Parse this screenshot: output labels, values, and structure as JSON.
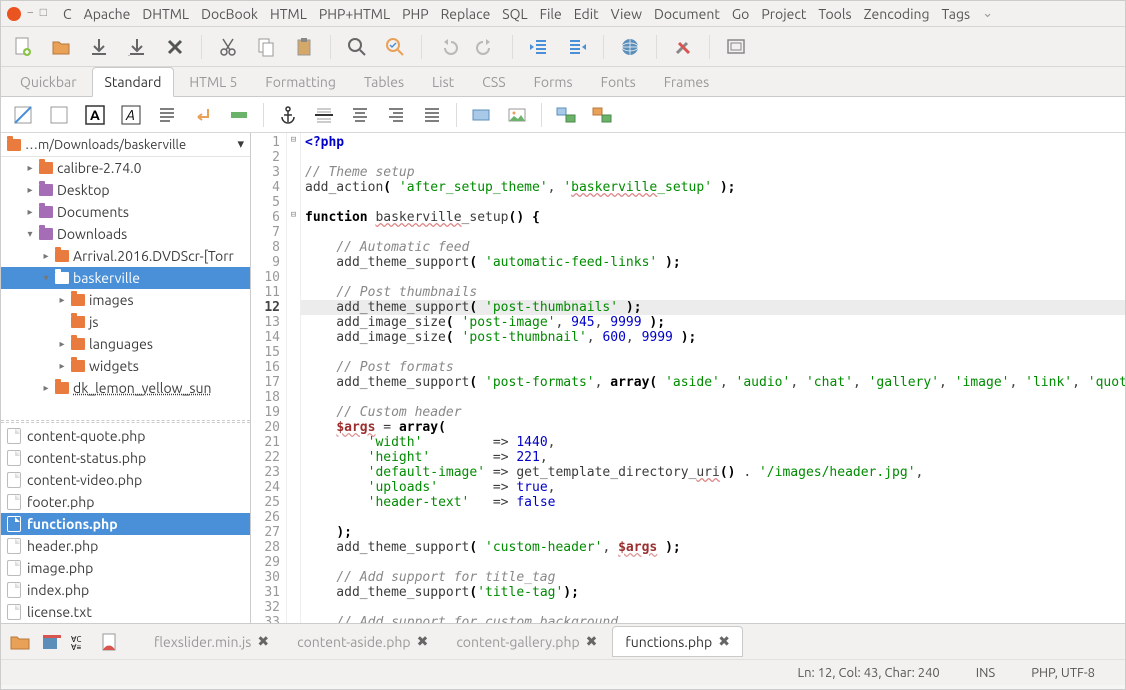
{
  "menus": [
    "C",
    "Apache",
    "DHTML",
    "DocBook",
    "HTML",
    "PHP+HTML",
    "PHP",
    "Replace",
    "SQL",
    "File",
    "Edit",
    "View",
    "Document",
    "Go",
    "Project",
    "Tools",
    "Zencoding",
    "Tags"
  ],
  "toolbar_tabs": [
    "Quickbar",
    "Standard",
    "HTML 5",
    "Formatting",
    "Tables",
    "List",
    "CSS",
    "Forms",
    "Fonts",
    "Frames"
  ],
  "active_toolbar_tab": 1,
  "path": "…m/Downloads/baskerville",
  "tree": [
    {
      "label": "calibre-2.74.0",
      "depth": 1,
      "exp": "▸",
      "folder": true
    },
    {
      "label": "Desktop",
      "depth": 1,
      "exp": "▸",
      "folder": true,
      "purple": true
    },
    {
      "label": "Documents",
      "depth": 1,
      "exp": "▸",
      "folder": true,
      "purple": true
    },
    {
      "label": "Downloads",
      "depth": 1,
      "exp": "▾",
      "folder": true,
      "purple": true
    },
    {
      "label": "Arrival.2016.DVDScr-[Torr",
      "depth": 2,
      "exp": "▸",
      "folder": true
    },
    {
      "label": "baskerville",
      "depth": 2,
      "exp": "▾",
      "folder": true,
      "selected": true
    },
    {
      "label": "images",
      "depth": 3,
      "exp": "▸",
      "folder": true
    },
    {
      "label": "js",
      "depth": 3,
      "exp": "",
      "folder": true
    },
    {
      "label": "languages",
      "depth": 3,
      "exp": "▸",
      "folder": true
    },
    {
      "label": "widgets",
      "depth": 3,
      "exp": "▸",
      "folder": true
    },
    {
      "label": "dk_lemon_yellow_sun",
      "depth": 2,
      "exp": "▸",
      "folder": true,
      "cut": true
    }
  ],
  "files": [
    {
      "name": "content-quote.php"
    },
    {
      "name": "content-status.php"
    },
    {
      "name": "content-video.php"
    },
    {
      "name": "footer.php"
    },
    {
      "name": "functions.php",
      "selected": true
    },
    {
      "name": "header.php"
    },
    {
      "name": "image.php"
    },
    {
      "name": "index.php"
    },
    {
      "name": "license.txt"
    }
  ],
  "doc_tabs": [
    {
      "name": "flexslider.min.js",
      "close": true
    },
    {
      "name": "content-aside.php",
      "close": true
    },
    {
      "name": "content-gallery.php",
      "close": true
    },
    {
      "name": "functions.php",
      "close": true,
      "active": true
    }
  ],
  "status": {
    "pos": "Ln: 12, Col: 43, Char: 240",
    "ins": "INS",
    "mode": "PHP, UTF-8"
  },
  "code_lines": [
    {
      "n": 1,
      "fold": "⊟",
      "html": "<span class='phptag'>&lt;?php</span>"
    },
    {
      "n": 2,
      "html": ""
    },
    {
      "n": 3,
      "html": "<span class='cmt'>// Theme setup</span>"
    },
    {
      "n": 4,
      "html": "add_action<span class='kw'>(</span> <span class='str'>'after_setup_theme'</span>, <span class='str'>'<span class='spell'>baskerville</span>_setup'</span> <span class='kw'>);</span>"
    },
    {
      "n": 5,
      "html": ""
    },
    {
      "n": 6,
      "fold": "⊟",
      "html": "<span class='kw'>function</span> <span class='spell'>baskerville</span>_setup<span class='kw'>() {</span>"
    },
    {
      "n": 7,
      "html": ""
    },
    {
      "n": 8,
      "html": "    <span class='cmt'>// Automatic feed</span>"
    },
    {
      "n": 9,
      "html": "    add_theme_support<span class='kw'>(</span> <span class='str'>'automatic-feed-links'</span> <span class='kw'>);</span>"
    },
    {
      "n": 10,
      "html": ""
    },
    {
      "n": 11,
      "html": "    <span class='cmt'>// Post thumbnails</span>"
    },
    {
      "n": 12,
      "bold": true,
      "hl": true,
      "html": "    add_theme_support<span class='kw'>(</span> <span class='str'>'post-thumbnails'</span> <span class='kw'>);</span>"
    },
    {
      "n": 13,
      "html": "    add_image_size<span class='kw'>(</span> <span class='str'>'post-image'</span>, <span class='num'>945</span>, <span class='num'>9999</span> <span class='kw'>);</span>"
    },
    {
      "n": 14,
      "html": "    add_image_size<span class='kw'>(</span> <span class='str'>'post-thumbnail'</span>, <span class='num'>600</span>, <span class='num'>9999</span> <span class='kw'>);</span>"
    },
    {
      "n": 15,
      "html": ""
    },
    {
      "n": 16,
      "html": "    <span class='cmt'>// Post formats</span>"
    },
    {
      "n": 17,
      "html": "    add_theme_support<span class='kw'>(</span> <span class='str'>'post-formats'</span>, <span class='kw'>array(</span> <span class='str'>'aside'</span>, <span class='str'>'audio'</span>, <span class='str'>'chat'</span>, <span class='str'>'gallery'</span>, <span class='str'>'image'</span>, <span class='str'>'link'</span>, <span class='str'>'quot</span>"
    },
    {
      "n": 18,
      "html": ""
    },
    {
      "n": 19,
      "html": "    <span class='cmt'>// Custom header</span>"
    },
    {
      "n": 20,
      "html": "    <span class='var'>$args</span> = <span class='kw'>array(</span>"
    },
    {
      "n": 21,
      "html": "        <span class='str'>'width'</span>         =&gt; <span class='num'>1440</span>,"
    },
    {
      "n": 22,
      "html": "        <span class='str'>'height'</span>        =&gt; <span class='num'>221</span>,"
    },
    {
      "n": 23,
      "html": "        <span class='str'>'default-image'</span> =&gt; get_template_directory_<span class='spell'>uri</span><span class='kw'>()</span> . <span class='str'>'/images/header.jpg'</span>,"
    },
    {
      "n": 24,
      "html": "        <span class='str'>'uploads'</span>       =&gt; <span class='num'>true</span>,"
    },
    {
      "n": 25,
      "html": "        <span class='str'>'header-text'</span>   =&gt; <span class='num'>false</span>"
    },
    {
      "n": 26,
      "html": ""
    },
    {
      "n": 27,
      "html": "    <span class='kw'>);</span>"
    },
    {
      "n": 28,
      "html": "    add_theme_support<span class='kw'>(</span> <span class='str'>'custom-header'</span>, <span class='var'>$args</span> <span class='kw'>);</span>"
    },
    {
      "n": 29,
      "html": ""
    },
    {
      "n": 30,
      "html": "    <span class='cmt'>// Add support for title_tag</span>"
    },
    {
      "n": 31,
      "html": "    add_theme_support<span class='kw'>(</span><span class='str'>'title-tag'</span><span class='kw'>);</span>"
    },
    {
      "n": 32,
      "html": ""
    },
    {
      "n": 33,
      "html": "    <span class='cmt'>// Add support for custom background</span>"
    }
  ]
}
